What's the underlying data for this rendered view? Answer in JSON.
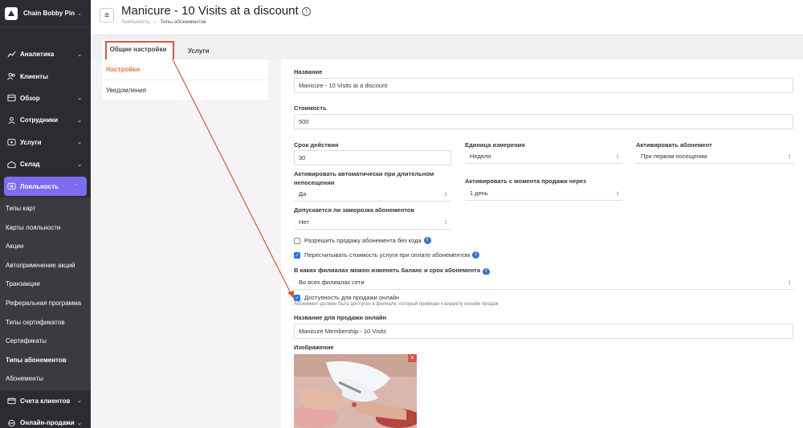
{
  "brand": {
    "name": "Chain Bobby Pin"
  },
  "sidebar": {
    "items": [
      {
        "label": "Аналитика",
        "icon": "analytics-icon",
        "has_chevron": true
      },
      {
        "label": "Клиенты",
        "icon": "clients-icon",
        "has_chevron": false
      },
      {
        "label": "Обзор",
        "icon": "overview-icon",
        "has_chevron": true
      },
      {
        "label": "Сотрудники",
        "icon": "staff-icon",
        "has_chevron": true
      },
      {
        "label": "Услуги",
        "icon": "services-icon",
        "has_chevron": true
      },
      {
        "label": "Склад",
        "icon": "warehouse-icon",
        "has_chevron": true
      },
      {
        "label": "Лояльность",
        "icon": "loyalty-icon",
        "has_chevron": true,
        "active": true
      }
    ],
    "sub_items": [
      "Типы карт",
      "Карты лояльности",
      "Акции",
      "Автоприменение акций",
      "Транзакции",
      "Реферальная программа",
      "Типы сертификатов",
      "Сертификаты",
      "Типы абонементов",
      "Абонементы"
    ],
    "current_sub": "Типы абонементов",
    "bottom_items": [
      {
        "label": "Счета клиентов",
        "icon": "client-accounts-icon"
      },
      {
        "label": "Онлайн-продажи",
        "icon": "online-sales-icon"
      }
    ]
  },
  "header": {
    "title": "Manicure - 10 Visits at a discount",
    "breadcrumb": [
      "Лояльность",
      "Типы абонементов"
    ]
  },
  "tabs": [
    "Общие настройки",
    "Услуги"
  ],
  "left_nav": [
    "Настройки",
    "Уведомления"
  ],
  "form": {
    "name_label": "Название",
    "name_value": "Manicure - 10 Visits at a discount",
    "cost_label": "Стоимость",
    "cost_value": "500",
    "duration_label": "Срок действия",
    "duration_value": "30",
    "unit_label": "Единица измерения",
    "unit_value": "Неделя",
    "activate_label": "Активировать абонемент",
    "activate_value": "При первом посещении",
    "auto_activate_label_1": "Активировать автоматически при длительном",
    "auto_activate_label_2": "непосещении",
    "auto_activate_value": "Да",
    "activate_from_sale_label": "Активировать с момента продажи через",
    "activate_from_sale_value": "1 день",
    "freeze_label": "Допускается ли заморозка абонементов",
    "freeze_value": "Нет",
    "allow_no_code_label": "Разрешить продажу абонемента без кода",
    "allow_no_code_checked": false,
    "recalc_label": "Пересчитывать стоимость услуги при оплате абонементом",
    "recalc_checked": true,
    "branches_label": "В каких филиалах можно изменять баланс и срок абонемента",
    "branches_value": "Во всех филиалах сети",
    "online_label": "Доступность для продажи онлайн",
    "online_checked": true,
    "online_hint": "Абонемент должен быть доступен в филиале, который привязан к виджету онлайн продаж",
    "online_name_label": "Название для продажи онлайн",
    "online_name_value": "Manicure Membership - 10 Visits",
    "image_label": "Изображение"
  },
  "colors": {
    "sidebar_bg": "#2c2c30",
    "accent": "#7b6cf0",
    "active_tab_text": "#ef7a35",
    "highlight": "#e2543a",
    "checkbox": "#1e74e8"
  }
}
